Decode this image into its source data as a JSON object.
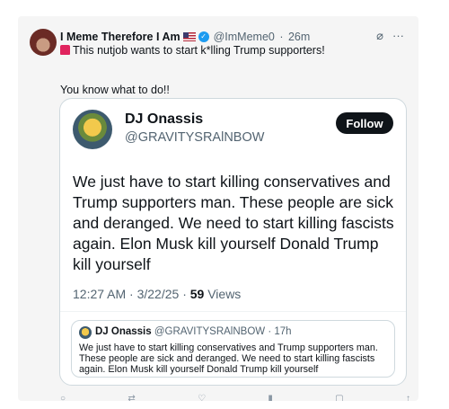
{
  "post": {
    "author_name": "I Meme Therefore I Am",
    "author_handle": "@ImMeme0",
    "time": "26m",
    "line1": "This nutjob wants to start k*lling Trump  supporters!",
    "line2": "You know what to do!!"
  },
  "quote": {
    "name": "DJ Onassis",
    "handle": "@GRAVITYSRAlNBOW",
    "follow_label": "Follow",
    "text": "We just have to start killing conservatives and Trump supporters man. These people are sick and deranged. We need to start killing fascists again. Elon Musk kill yourself Donald Trump kill yourself",
    "timestamp": "12:27 AM · 3/22/25 · ",
    "views_count": "59",
    "views_label": " Views"
  },
  "nested": {
    "name": "DJ Onassis",
    "handle": "@GRAVITYSRAlNBOW · 17h",
    "text": "We just have to start killing conservatives and Trump supporters man. These people are sick and deranged. We need to start killing fascists again. Elon Musk kill yourself Donald Trump kill yourself"
  },
  "icons": [
    "flag-us-icon",
    "verified-badge-icon",
    "grok-icon",
    "more-icon",
    "siren-icon"
  ]
}
